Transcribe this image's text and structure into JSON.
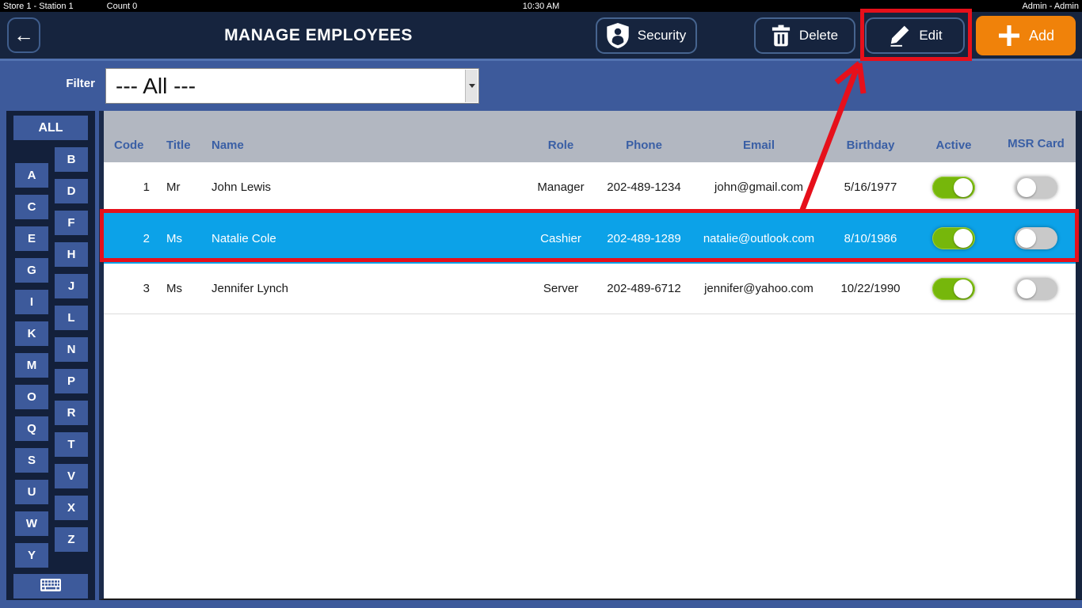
{
  "status_bar": {
    "store": "Store 1 - Station 1",
    "count": "Count 0",
    "time": "10:30 AM",
    "user": "Admin - Admin"
  },
  "header": {
    "title": "MANAGE EMPLOYEES",
    "back_icon": "←",
    "security_label": "Security",
    "delete_label": "Delete",
    "edit_label": "Edit",
    "add_label": "Add"
  },
  "filter": {
    "label": "Filter",
    "selected_value": "--- All ---"
  },
  "sidebar": {
    "all_label": "ALL",
    "letters": [
      "A",
      "B",
      "C",
      "D",
      "E",
      "F",
      "G",
      "H",
      "I",
      "J",
      "K",
      "L",
      "M",
      "N",
      "O",
      "P",
      "Q",
      "R",
      "S",
      "T",
      "U",
      "V",
      "W",
      "X",
      "Y",
      "Z"
    ]
  },
  "icons": {
    "back": "arrow-left",
    "security": "shield-user",
    "delete": "trash",
    "edit": "pencil",
    "add": "plus",
    "keyboard": "keyboard",
    "filter_dropdown": "caret-down"
  },
  "table": {
    "columns": [
      "Code",
      "Title",
      "Name",
      "Role",
      "Phone",
      "Email",
      "Birthday",
      "Active",
      "MSR Card"
    ],
    "rows": [
      {
        "code": "1",
        "title": "Mr",
        "name": "John Lewis",
        "role": "Manager",
        "phone": "202-489-1234",
        "email": "john@gmail.com",
        "birthday": "5/16/1977",
        "active": true,
        "msr_card": false,
        "selected": false
      },
      {
        "code": "2",
        "title": "Ms",
        "name": "Natalie Cole",
        "role": "Cashier",
        "phone": "202-489-1289",
        "email": "natalie@outlook.com",
        "birthday": "8/10/1986",
        "active": true,
        "msr_card": false,
        "selected": true
      },
      {
        "code": "3",
        "title": "Ms",
        "name": "Jennifer Lynch",
        "role": "Server",
        "phone": "202-489-6712",
        "email": "jennifer@yahoo.com",
        "birthday": "10/22/1990",
        "active": true,
        "msr_card": false,
        "selected": false
      }
    ]
  },
  "colors": {
    "annotation_red": "#e6101b",
    "selected_row_blue": "#0ca2e8",
    "toggle_on_green": "#76b70b",
    "toggle_off_gray": "#c9c9c9",
    "add_button_orange": "#f0820a",
    "header_navy": "#16243e",
    "page_blue": "#3d5a9b",
    "table_header_gray": "#b2b7c1"
  }
}
